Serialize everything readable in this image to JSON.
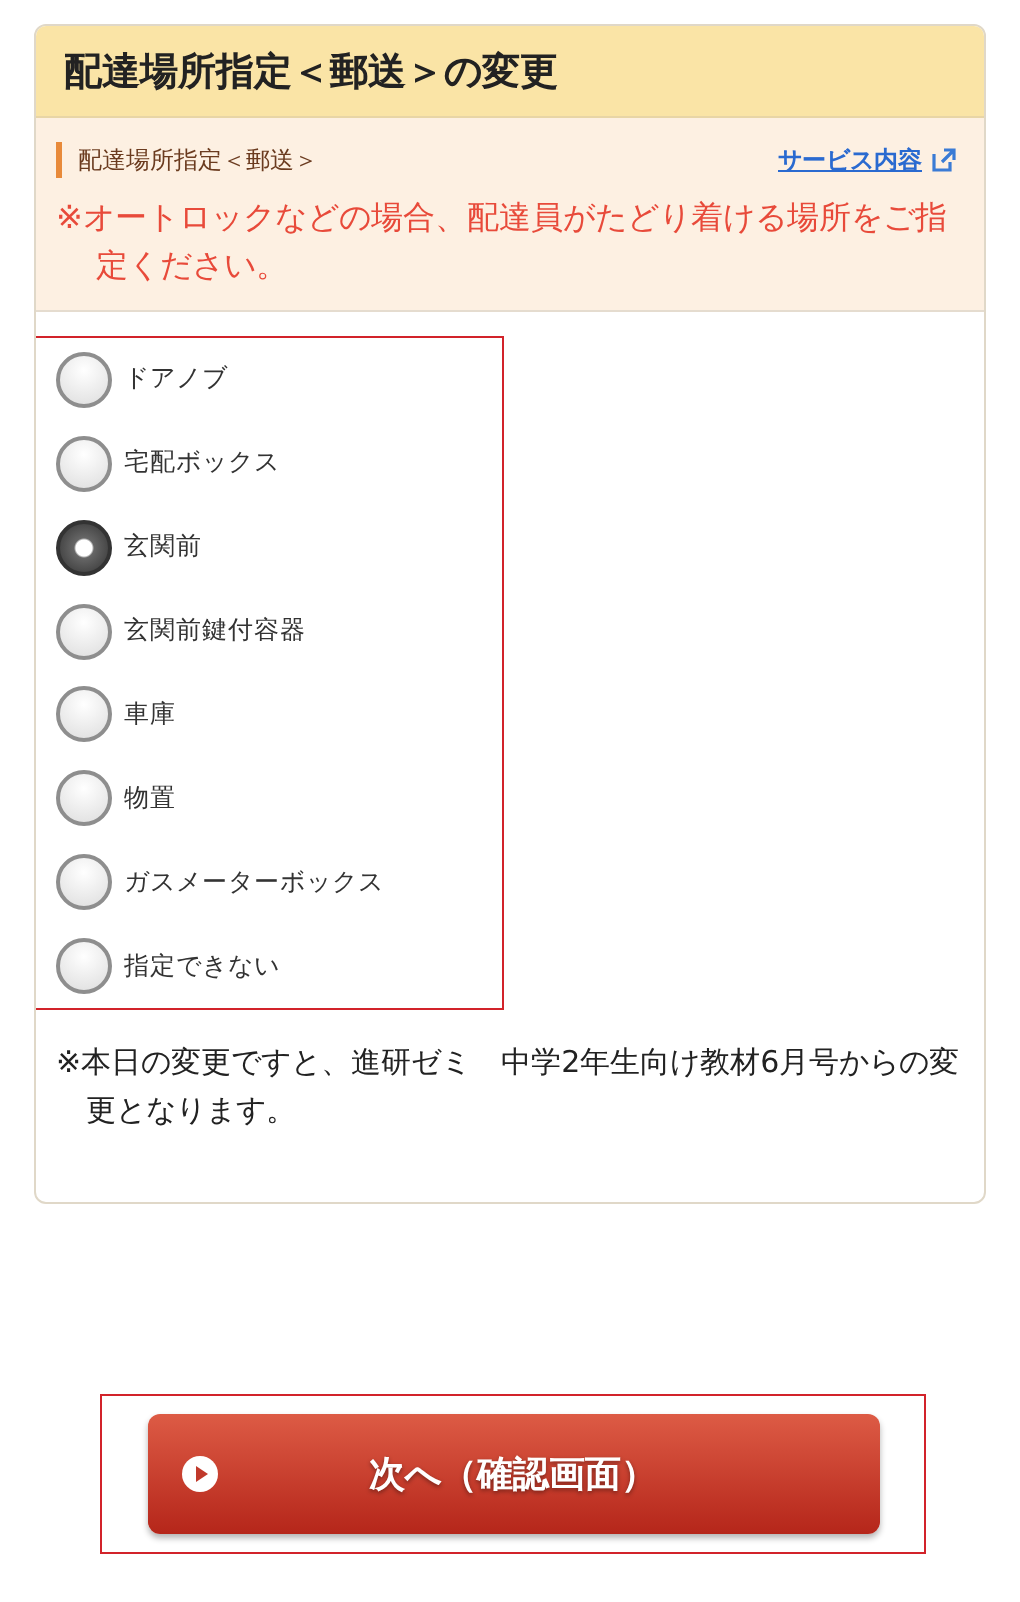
{
  "card": {
    "title": "配達場所指定＜郵送＞の変更",
    "section": {
      "label": "配達場所指定＜郵送＞",
      "link": "サービス内容",
      "notice": "※オートロックなどの場合、配達員がたどり着ける場所をご指定ください。"
    },
    "options": [
      {
        "label": "ドアノブ",
        "selected": false
      },
      {
        "label": "宅配ボックス",
        "selected": false
      },
      {
        "label": "玄関前",
        "selected": true
      },
      {
        "label": "玄関前鍵付容器",
        "selected": false
      },
      {
        "label": "車庫",
        "selected": false
      },
      {
        "label": "物置",
        "selected": false
      },
      {
        "label": "ガスメーターボックス",
        "selected": false
      },
      {
        "label": "指定できない",
        "selected": false
      }
    ],
    "note": "※本日の変更ですと、進研ゼミ　中学2年生向け教材6月号からの変更となります。"
  },
  "next_button": {
    "label": "次へ（確認画面）"
  }
}
